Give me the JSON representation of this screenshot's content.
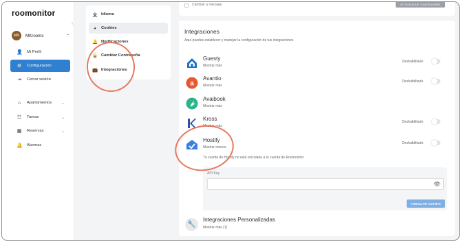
{
  "app": {
    "logo": "roomonitor",
    "collapse_icon": "chevron-left-icon"
  },
  "user": {
    "initials": "MR",
    "name": "MKrooms"
  },
  "sidebar": {
    "items": [
      {
        "label": "Mi Perfil",
        "icon": "user-icon"
      },
      {
        "label": "Configuración",
        "icon": "gear-icon",
        "active": true
      },
      {
        "label": "Cerrar sesión",
        "icon": "logout-icon"
      },
      {
        "label": "Apartamentos",
        "icon": "home-icon"
      },
      {
        "label": "Tareas",
        "icon": "tasks-icon"
      },
      {
        "label": "Reservas",
        "icon": "calendar-icon"
      },
      {
        "label": "Alarmas",
        "icon": "bell-icon"
      }
    ]
  },
  "settings_menu": {
    "items": [
      {
        "label": "Idioma",
        "icon": "translate-icon"
      },
      {
        "label": "Cookies",
        "icon": "cookie-icon",
        "active": true
      },
      {
        "label": "Notificaciones",
        "icon": "bell-icon"
      },
      {
        "label": "Cambiar Contraseña",
        "icon": "lock-icon"
      },
      {
        "label": "Integraciones",
        "icon": "briefcase-icon"
      }
    ]
  },
  "top": {
    "note": "Cambiar a mensaje",
    "button": "ACTUALIZAR CONTRASEÑA"
  },
  "integrations": {
    "title": "Integraciones",
    "subtitle": "Aquí puedes establecer y manejar la configuración de tus integraciones",
    "disabled_label": "Deshabilitado",
    "items": [
      {
        "name": "Guesty",
        "more": "Mostrar más",
        "status": "Deshabilitado",
        "icon": "guesty-logo-icon",
        "color": "#1a73c8"
      },
      {
        "name": "Avantio",
        "more": "Mostrar más",
        "status": "Deshabilitado",
        "icon": "avantio-logo-icon",
        "color": "#e8572f"
      },
      {
        "name": "Avaibook",
        "more": "Mostrar más",
        "status": "",
        "icon": "avaibook-logo-icon",
        "color": "#2bb38a"
      },
      {
        "name": "Kross",
        "more": "Mostrar más",
        "status": "Deshabilitado",
        "icon": "kross-logo-icon",
        "color": "#2a4fa8"
      },
      {
        "name": "Hostify",
        "more": "Mostrar menos",
        "status": "Deshabilitado",
        "icon": "hostify-logo-icon",
        "color": "#3b7fe0"
      }
    ],
    "hostify_note": "Tu cuenta de Hostify no está vinculada a tu cuenta de Roomonitor",
    "api_key_label": "API Key",
    "link_button": "VINCULAR CUENTA",
    "custom": {
      "name": "Integraciones Personalizadas",
      "more": "Mostrar más (1)"
    }
  },
  "colors": {
    "accent": "#2f80d1",
    "annotation": "#e8785e"
  }
}
